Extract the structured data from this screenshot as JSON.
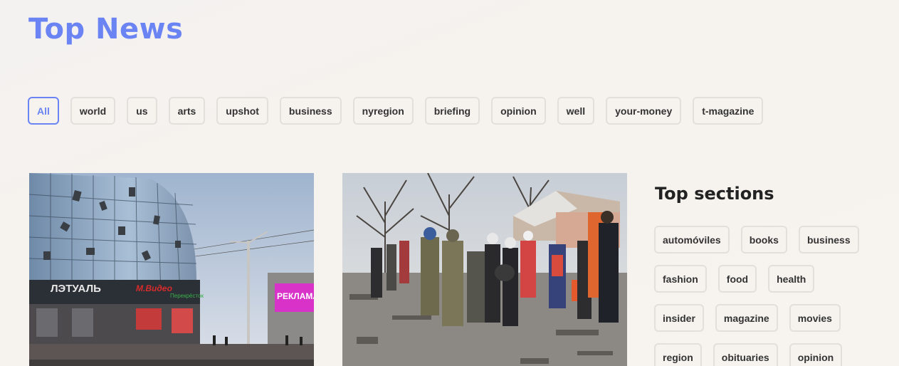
{
  "header": {
    "title": "Top News"
  },
  "filters": [
    {
      "label": "All",
      "active": true
    },
    {
      "label": "world"
    },
    {
      "label": "us"
    },
    {
      "label": "arts"
    },
    {
      "label": "upshot"
    },
    {
      "label": "business"
    },
    {
      "label": "nyregion"
    },
    {
      "label": "briefing"
    },
    {
      "label": "opinion"
    },
    {
      "label": "well"
    },
    {
      "label": "your-money"
    },
    {
      "label": "t-magazine"
    }
  ],
  "sidebar": {
    "title": "Top sections",
    "rows": [
      [
        "automóviles",
        "books",
        "business"
      ],
      [
        "fashion",
        "food",
        "health"
      ],
      [
        "insider",
        "magazine",
        "movies"
      ],
      [
        "region",
        "obituaries",
        "opinion"
      ]
    ]
  },
  "articles": [
    {
      "image_alt": "Damaged shopping center",
      "image_text": [
        "ЛЭТУАЛЬ",
        "М.Видео",
        "Перекрёсток",
        "РЕКЛАМА"
      ]
    },
    {
      "image_alt": "Rescuers carrying a person",
      "image_text": []
    }
  ],
  "colors": {
    "accent": "#6b84f3",
    "background": "#f6f3ef",
    "chip_border": "#e3e0dc"
  }
}
